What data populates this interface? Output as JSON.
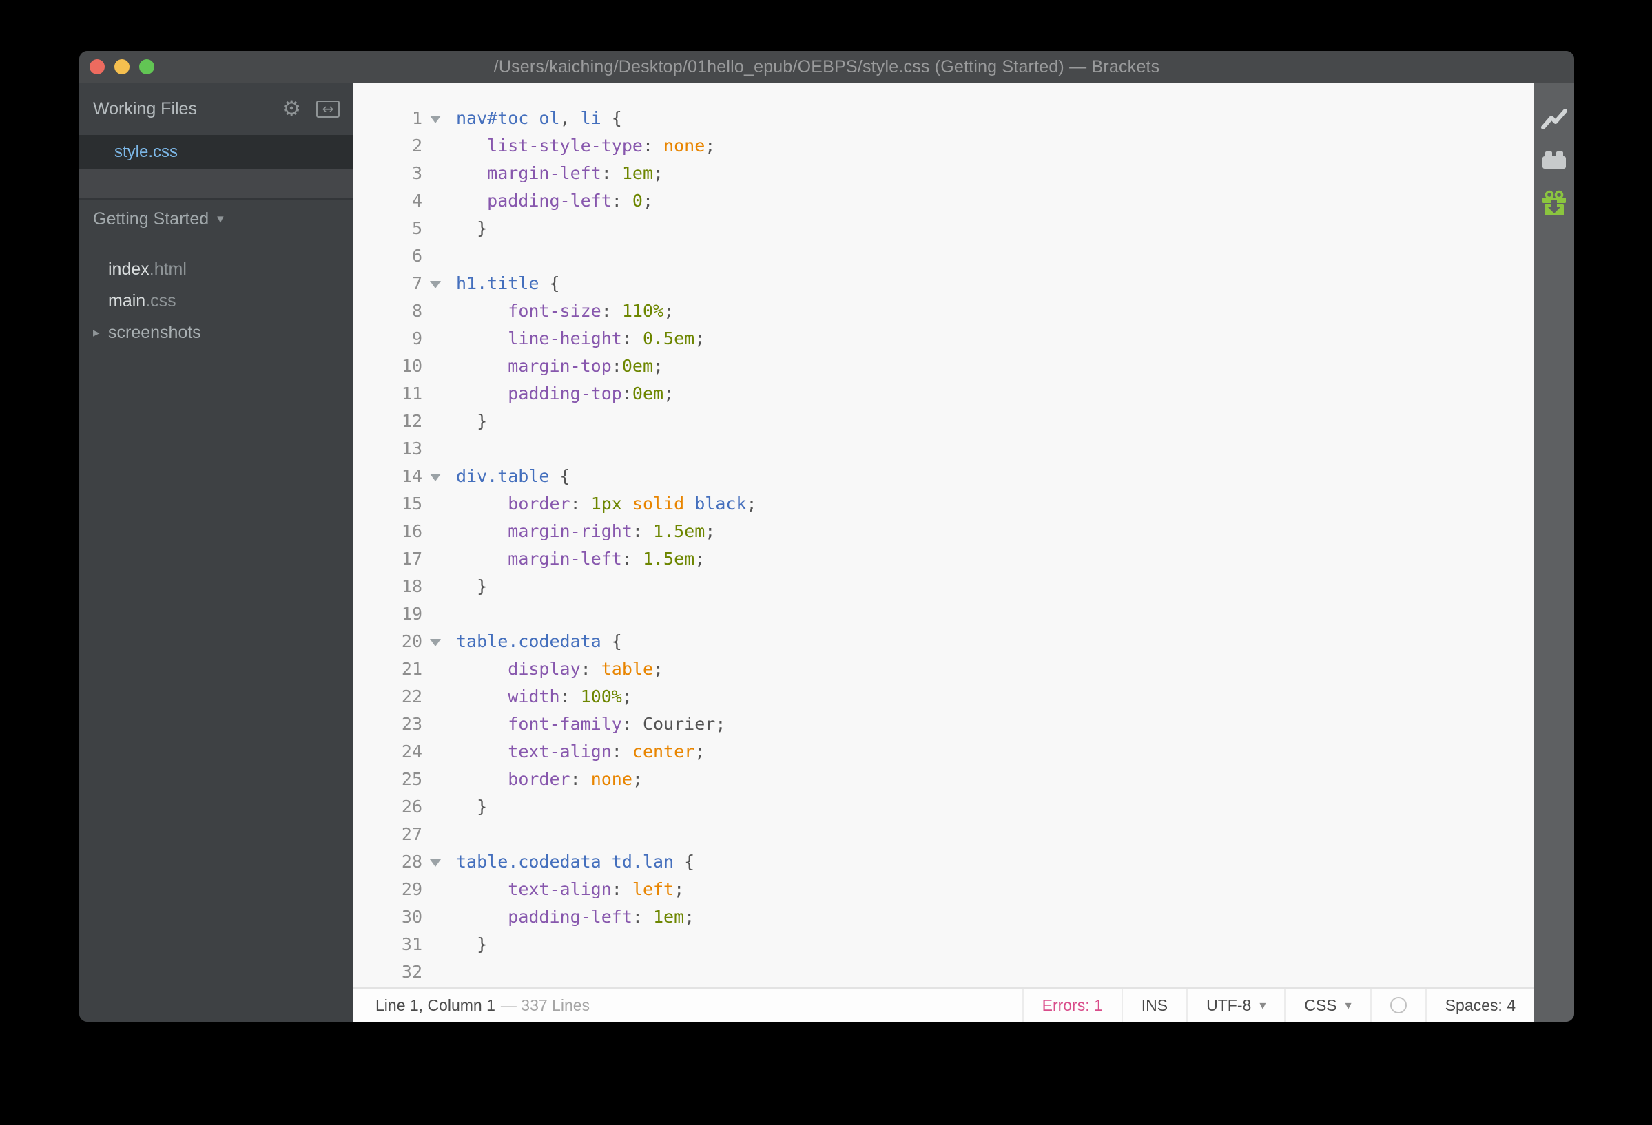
{
  "window": {
    "title": "/Users/kaiching/Desktop/01hello_epub/OEBPS/style.css (Getting Started) — Brackets",
    "traffic_lights": [
      "close",
      "minimize",
      "zoom"
    ]
  },
  "icons": {
    "gear": "⚙",
    "split_arrow": "↔",
    "caret_down": "▾",
    "triangle_right": "▸"
  },
  "sidebar": {
    "working_files_label": "Working Files",
    "open_files": [
      {
        "name": "style.css",
        "selected": true
      }
    ],
    "project": {
      "name": "Getting Started"
    },
    "tree": [
      {
        "base": "index",
        "ext": ".html",
        "type": "file"
      },
      {
        "base": "main",
        "ext": ".css",
        "type": "file"
      },
      {
        "base": "screenshots",
        "ext": "",
        "type": "folder-collapsed"
      }
    ]
  },
  "editor": {
    "lines": [
      {
        "n": 1,
        "fold": true,
        "tokens": [
          [
            "sel",
            "nav#toc ol"
          ],
          [
            "pun",
            ", "
          ],
          [
            "sel",
            "li"
          ],
          [
            "pun",
            " {"
          ]
        ]
      },
      {
        "n": 2,
        "fold": false,
        "tokens": [
          [
            "pun",
            "   "
          ],
          [
            "prop",
            "list-style-type"
          ],
          [
            "pun",
            ": "
          ],
          [
            "atom",
            "none"
          ],
          [
            "pun",
            ";"
          ]
        ]
      },
      {
        "n": 3,
        "fold": false,
        "tokens": [
          [
            "pun",
            "   "
          ],
          [
            "prop",
            "margin-left"
          ],
          [
            "pun",
            ": "
          ],
          [
            "num",
            "1em"
          ],
          [
            "pun",
            ";"
          ]
        ]
      },
      {
        "n": 4,
        "fold": false,
        "tokens": [
          [
            "pun",
            "   "
          ],
          [
            "prop",
            "padding-left"
          ],
          [
            "pun",
            ": "
          ],
          [
            "num",
            "0"
          ],
          [
            "pun",
            ";"
          ]
        ]
      },
      {
        "n": 5,
        "fold": false,
        "tokens": [
          [
            "pun",
            "  }"
          ]
        ]
      },
      {
        "n": 6,
        "fold": false,
        "tokens": []
      },
      {
        "n": 7,
        "fold": true,
        "tokens": [
          [
            "sel",
            "h1.title"
          ],
          [
            "pun",
            " {"
          ]
        ]
      },
      {
        "n": 8,
        "fold": false,
        "tokens": [
          [
            "pun",
            "     "
          ],
          [
            "prop",
            "font-size"
          ],
          [
            "pun",
            ": "
          ],
          [
            "num",
            "110%"
          ],
          [
            "pun",
            ";"
          ]
        ]
      },
      {
        "n": 9,
        "fold": false,
        "tokens": [
          [
            "pun",
            "     "
          ],
          [
            "prop",
            "line-height"
          ],
          [
            "pun",
            ": "
          ],
          [
            "num",
            "0.5em"
          ],
          [
            "pun",
            ";"
          ]
        ]
      },
      {
        "n": 10,
        "fold": false,
        "tokens": [
          [
            "pun",
            "     "
          ],
          [
            "prop",
            "margin-top"
          ],
          [
            "pun",
            ":"
          ],
          [
            "num",
            "0em"
          ],
          [
            "pun",
            ";"
          ]
        ]
      },
      {
        "n": 11,
        "fold": false,
        "tokens": [
          [
            "pun",
            "     "
          ],
          [
            "prop",
            "padding-top"
          ],
          [
            "pun",
            ":"
          ],
          [
            "num",
            "0em"
          ],
          [
            "pun",
            ";"
          ]
        ]
      },
      {
        "n": 12,
        "fold": false,
        "tokens": [
          [
            "pun",
            "  }"
          ]
        ]
      },
      {
        "n": 13,
        "fold": false,
        "tokens": []
      },
      {
        "n": 14,
        "fold": true,
        "tokens": [
          [
            "sel",
            "div.table"
          ],
          [
            "pun",
            " {"
          ]
        ]
      },
      {
        "n": 15,
        "fold": false,
        "tokens": [
          [
            "pun",
            "     "
          ],
          [
            "prop",
            "border"
          ],
          [
            "pun",
            ": "
          ],
          [
            "num",
            "1px"
          ],
          [
            "pun",
            " "
          ],
          [
            "atom",
            "solid"
          ],
          [
            "pun",
            " "
          ],
          [
            "kw",
            "black"
          ],
          [
            "pun",
            ";"
          ]
        ]
      },
      {
        "n": 16,
        "fold": false,
        "tokens": [
          [
            "pun",
            "     "
          ],
          [
            "prop",
            "margin-right"
          ],
          [
            "pun",
            ": "
          ],
          [
            "num",
            "1.5em"
          ],
          [
            "pun",
            ";"
          ]
        ]
      },
      {
        "n": 17,
        "fold": false,
        "tokens": [
          [
            "pun",
            "     "
          ],
          [
            "prop",
            "margin-left"
          ],
          [
            "pun",
            ": "
          ],
          [
            "num",
            "1.5em"
          ],
          [
            "pun",
            ";"
          ]
        ]
      },
      {
        "n": 18,
        "fold": false,
        "tokens": [
          [
            "pun",
            "  }"
          ]
        ]
      },
      {
        "n": 19,
        "fold": false,
        "tokens": []
      },
      {
        "n": 20,
        "fold": true,
        "tokens": [
          [
            "sel",
            "table.codedata"
          ],
          [
            "pun",
            " {"
          ]
        ]
      },
      {
        "n": 21,
        "fold": false,
        "tokens": [
          [
            "pun",
            "     "
          ],
          [
            "prop",
            "display"
          ],
          [
            "pun",
            ": "
          ],
          [
            "atom",
            "table"
          ],
          [
            "pun",
            ";"
          ]
        ]
      },
      {
        "n": 22,
        "fold": false,
        "tokens": [
          [
            "pun",
            "     "
          ],
          [
            "prop",
            "width"
          ],
          [
            "pun",
            ": "
          ],
          [
            "num",
            "100%"
          ],
          [
            "pun",
            ";"
          ]
        ]
      },
      {
        "n": 23,
        "fold": false,
        "tokens": [
          [
            "pun",
            "     "
          ],
          [
            "prop",
            "font-family"
          ],
          [
            "pun",
            ": "
          ],
          [
            "plain",
            "Courier"
          ],
          [
            "pun",
            ";"
          ]
        ]
      },
      {
        "n": 24,
        "fold": false,
        "tokens": [
          [
            "pun",
            "     "
          ],
          [
            "prop",
            "text-align"
          ],
          [
            "pun",
            ": "
          ],
          [
            "atom",
            "center"
          ],
          [
            "pun",
            ";"
          ]
        ]
      },
      {
        "n": 25,
        "fold": false,
        "tokens": [
          [
            "pun",
            "     "
          ],
          [
            "prop",
            "border"
          ],
          [
            "pun",
            ": "
          ],
          [
            "atom",
            "none"
          ],
          [
            "pun",
            ";"
          ]
        ]
      },
      {
        "n": 26,
        "fold": false,
        "tokens": [
          [
            "pun",
            "  }"
          ]
        ]
      },
      {
        "n": 27,
        "fold": false,
        "tokens": []
      },
      {
        "n": 28,
        "fold": true,
        "tokens": [
          [
            "sel",
            "table.codedata td.lan"
          ],
          [
            "pun",
            " {"
          ]
        ]
      },
      {
        "n": 29,
        "fold": false,
        "tokens": [
          [
            "pun",
            "     "
          ],
          [
            "prop",
            "text-align"
          ],
          [
            "pun",
            ": "
          ],
          [
            "atom",
            "left"
          ],
          [
            "pun",
            ";"
          ]
        ]
      },
      {
        "n": 30,
        "fold": false,
        "tokens": [
          [
            "pun",
            "     "
          ],
          [
            "prop",
            "padding-left"
          ],
          [
            "pun",
            ": "
          ],
          [
            "num",
            "1em"
          ],
          [
            "pun",
            ";"
          ]
        ]
      },
      {
        "n": 31,
        "fold": false,
        "tokens": [
          [
            "pun",
            "  }"
          ]
        ]
      },
      {
        "n": 32,
        "fold": false,
        "tokens": []
      }
    ]
  },
  "toolbar": {
    "buttons": [
      {
        "icon": "live-preview-icon"
      },
      {
        "icon": "extension-manager-icon"
      },
      {
        "icon": "extension-updates-icon"
      }
    ]
  },
  "statusbar": {
    "cursor": "Line 1, Column 1",
    "lines_info": "— 337 Lines",
    "errors": "Errors: 1",
    "ins": "INS",
    "encoding": "UTF-8",
    "language": "CSS",
    "spaces": "Spaces:  4"
  },
  "colors": {
    "selector_blue": "#446fbd",
    "property_purple": "#8757ad",
    "number_olive": "#6d8600",
    "atom_orange": "#e88501",
    "error_pink": "#d94c8a",
    "extension_green": "#8bc53f",
    "sidebar_bg": "#3e4144",
    "titlebar_bg": "#47494b",
    "editor_bg": "#f8f8f8"
  }
}
